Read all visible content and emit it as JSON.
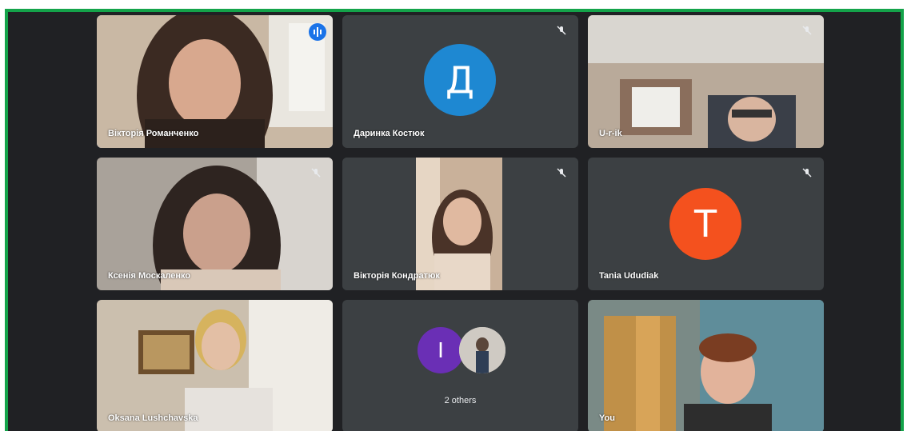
{
  "participants": [
    {
      "name": "Вікторія Романченко",
      "type": "video",
      "speaking": true
    },
    {
      "name": "Даринка Костюк",
      "type": "avatar",
      "initial": "Д",
      "avatar_color": "#1e88d2",
      "muted": true
    },
    {
      "name": "U-r-ik",
      "type": "video",
      "muted": true
    },
    {
      "name": "Ксенія Москаленко",
      "type": "video",
      "muted": true
    },
    {
      "name": "Вікторія Кондратюк",
      "type": "video",
      "muted": true
    },
    {
      "name": "Tania Ududiak",
      "type": "avatar",
      "initial": "T",
      "avatar_color": "#f4511e",
      "muted": true
    },
    {
      "name": "Oksana Lushchavska",
      "type": "video"
    },
    {
      "name": "2 others",
      "type": "group",
      "initial": "I",
      "avatar_color": "#6a2fb5"
    },
    {
      "name": "You",
      "type": "video"
    }
  ],
  "colors": {
    "frame_border": "#14a34a",
    "background": "#202124",
    "tile": "#3c4043",
    "active_outline": "#8ab4f8"
  }
}
